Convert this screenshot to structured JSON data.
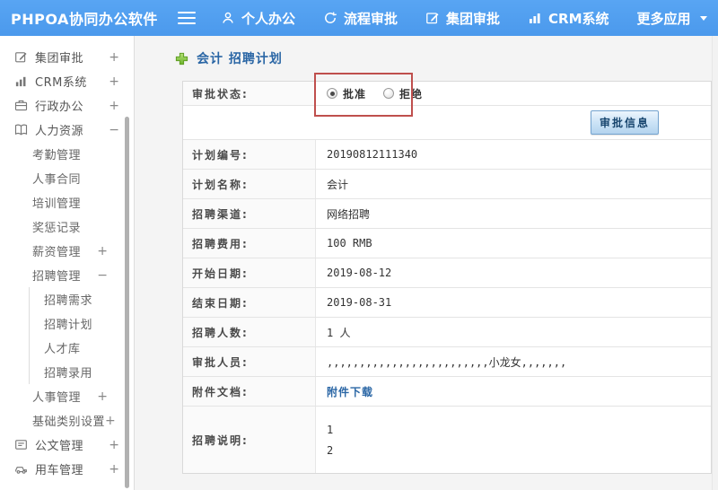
{
  "header": {
    "brand": "PHPOA协同办公软件",
    "nav": [
      {
        "label": "个人办公",
        "icon": "user-icon"
      },
      {
        "label": "流程审批",
        "icon": "refresh-icon"
      },
      {
        "label": "集团审批",
        "icon": "edit-square-icon"
      },
      {
        "label": "CRM系统",
        "icon": "bar-chart-icon"
      },
      {
        "label": "更多应用",
        "icon": "caret-down-icon"
      }
    ]
  },
  "sidebar": {
    "items": [
      {
        "label": "集团审批",
        "icon": "edit-square-icon",
        "level": 1,
        "toggle": "+"
      },
      {
        "label": "CRM系统",
        "icon": "bar-chart-icon",
        "level": 1,
        "toggle": "+"
      },
      {
        "label": "行政办公",
        "icon": "briefcase-icon",
        "level": 1,
        "toggle": "+"
      },
      {
        "label": "人力资源",
        "icon": "book-icon",
        "level": 1,
        "toggle": "−"
      },
      {
        "label": "考勤管理",
        "level": 2,
        "toggle": ""
      },
      {
        "label": "人事合同",
        "level": 2,
        "toggle": ""
      },
      {
        "label": "培训管理",
        "level": 2,
        "toggle": ""
      },
      {
        "label": "奖惩记录",
        "level": 2,
        "toggle": ""
      },
      {
        "label": "薪资管理",
        "level": 2,
        "toggle": "+"
      },
      {
        "label": "招聘管理",
        "level": 2,
        "toggle": "−"
      },
      {
        "label": "招聘需求",
        "level": 3,
        "toggle": ""
      },
      {
        "label": "招聘计划",
        "level": 3,
        "toggle": ""
      },
      {
        "label": "人才库",
        "level": 3,
        "toggle": ""
      },
      {
        "label": "招聘录用",
        "level": 3,
        "toggle": ""
      },
      {
        "label": "人事管理",
        "level": 2,
        "toggle": "+"
      },
      {
        "label": "基础类别设置",
        "level": 2,
        "toggle": "+"
      },
      {
        "label": "公文管理",
        "icon": "document-icon",
        "level": 1,
        "toggle": "+"
      },
      {
        "label": "用车管理",
        "icon": "car-icon",
        "level": 1,
        "toggle": "+"
      }
    ]
  },
  "main": {
    "title": "会计 招聘计划",
    "approval": {
      "label": "审批状态:",
      "options": [
        {
          "label": "批准",
          "checked": true
        },
        {
          "label": "拒绝",
          "checked": false
        }
      ]
    },
    "button_label": "审批信息",
    "rows": [
      {
        "label": "计划编号:",
        "value": "20190812111340"
      },
      {
        "label": "计划名称:",
        "value": "会计"
      },
      {
        "label": "招聘渠道:",
        "value": "网络招聘"
      },
      {
        "label": "招聘费用:",
        "value": "100 RMB"
      },
      {
        "label": "开始日期:",
        "value": "2019-08-12"
      },
      {
        "label": "结束日期:",
        "value": "2019-08-31"
      },
      {
        "label": "招聘人数:",
        "value": "1 人"
      },
      {
        "label": "审批人员:",
        "value": ",,,,,,,,,,,,,,,,,,,,,,,,,小龙女,,,,,,,"
      },
      {
        "label": "附件文档:",
        "value": "附件下载",
        "link": true
      },
      {
        "label": "招聘说明:",
        "lines": [
          "1",
          "2"
        ]
      }
    ]
  },
  "colors": {
    "header_blue": "#58a5f3",
    "title_blue": "#2a66a5",
    "link_blue": "#2a66a5",
    "annotation_red": "#bf4f4d",
    "button_border_blue": "#74a3cf",
    "button_text_blue": "#17456e",
    "plus_green": "#7cbf3f"
  }
}
